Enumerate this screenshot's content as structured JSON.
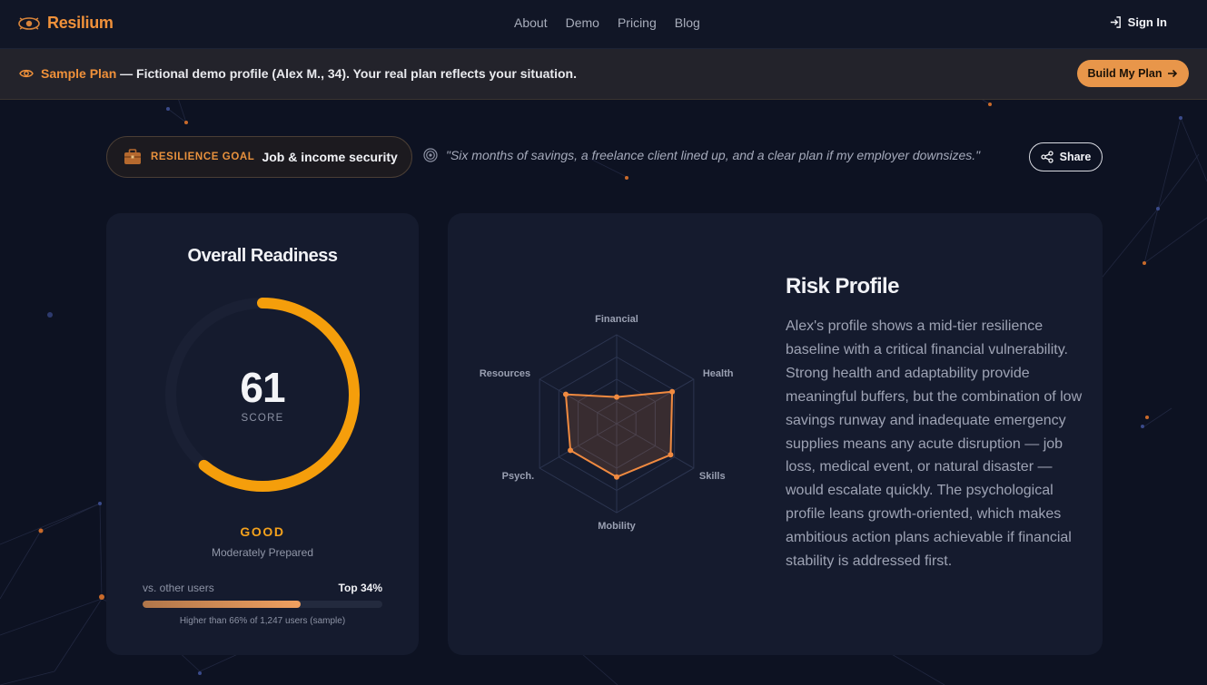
{
  "app": {
    "name": "Resilium"
  },
  "nav": {
    "links": [
      "About",
      "Demo",
      "Pricing",
      "Blog"
    ],
    "signin_label": "Sign In"
  },
  "banner": {
    "highlight": "Sample Plan",
    "text": " — Fictional demo profile (Alex M., 34). Your real plan reflects your situation.",
    "button_label": "Build My Plan"
  },
  "goal": {
    "label": "RESILIENCE GOAL",
    "value": "Job & income security",
    "quote": "\"Six months of savings, a freelance client lined up, and a clear plan if my employer downsizes.\"",
    "share_label": "Share"
  },
  "readiness": {
    "title": "Overall Readiness",
    "score": "61",
    "score_caption": "SCORE",
    "score_fraction": 0.61,
    "grade": "GOOD",
    "grade_sub": "Moderately Prepared",
    "compare_label": "vs. other users",
    "compare_rank": "Top 34%",
    "compare_fraction": 0.66,
    "compare_note": "Higher than 66% of 1,247 users (sample)"
  },
  "risk": {
    "title": "Risk Profile",
    "text": "Alex's profile shows a mid-tier resilience baseline with a critical financial vulnerability. Strong health and adaptability provide meaningful buffers, but the combination of low savings runway and inadequate emergency supplies means any acute disruption — job loss, medical event, or natural disaster — would escalate quickly. The psychological profile leans growth-oriented, which makes ambitious action plans achievable if financial stability is addressed first."
  },
  "chart_data": {
    "type": "radar",
    "categories": [
      "Financial",
      "Health",
      "Skills",
      "Mobility",
      "Psych.",
      "Resources"
    ],
    "values": [
      0.3,
      0.72,
      0.7,
      0.6,
      0.6,
      0.66
    ],
    "range": [
      0,
      1
    ],
    "rings": 4
  },
  "colors": {
    "accent": "#f0913a",
    "gauge": "#f59e0b",
    "radar_stroke": "#f08a40",
    "background": "#0d1222",
    "card": "#151b2e"
  }
}
